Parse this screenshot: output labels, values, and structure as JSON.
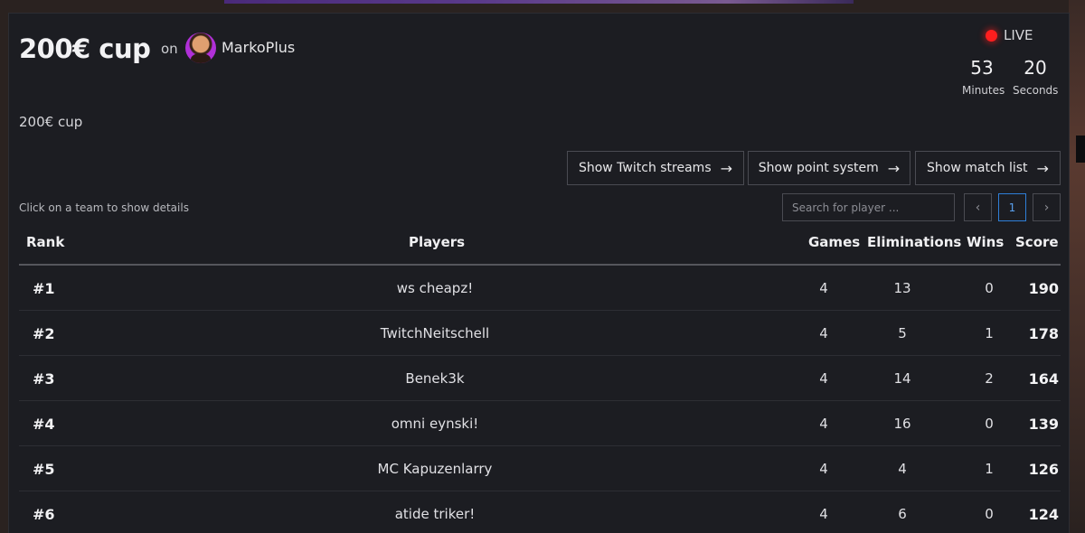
{
  "tournament": {
    "title": "200€ cup",
    "on_label": "on",
    "streamer": "MarkoPlus",
    "description": "200€ cup"
  },
  "live": {
    "label": "LIVE",
    "minutes_value": "53",
    "minutes_label": "Minutes",
    "seconds_value": "20",
    "seconds_label": "Seconds"
  },
  "actions": {
    "twitch_streams": "Show Twitch streams",
    "point_system": "Show point system",
    "match_list": "Show match list"
  },
  "hint": "Click on a team to show details",
  "search": {
    "placeholder": "Search for player ..."
  },
  "pagination": {
    "current_page": "1"
  },
  "table": {
    "headers": {
      "rank": "Rank",
      "players": "Players",
      "games": "Games",
      "eliminations": "Eliminations",
      "wins": "Wins",
      "score": "Score"
    },
    "rows": [
      {
        "rank": "#1",
        "players": "ws cheapz!",
        "games": "4",
        "eliminations": "13",
        "wins": "0",
        "score": "190"
      },
      {
        "rank": "#2",
        "players": "TwitchNeitschell",
        "games": "4",
        "eliminations": "5",
        "wins": "1",
        "score": "178"
      },
      {
        "rank": "#3",
        "players": "Benek3k",
        "games": "4",
        "eliminations": "14",
        "wins": "2",
        "score": "164"
      },
      {
        "rank": "#4",
        "players": "omni eynski!",
        "games": "4",
        "eliminations": "16",
        "wins": "0",
        "score": "139"
      },
      {
        "rank": "#5",
        "players": "MC Kapuzenlarry",
        "games": "4",
        "eliminations": "4",
        "wins": "1",
        "score": "126"
      },
      {
        "rank": "#6",
        "players": "atide triker!",
        "games": "4",
        "eliminations": "6",
        "wins": "0",
        "score": "124"
      }
    ]
  },
  "colors": {
    "panel_bg": "#1c1d22",
    "live_dot": "#ff1e1e",
    "active_page": "#2f7fd8"
  }
}
